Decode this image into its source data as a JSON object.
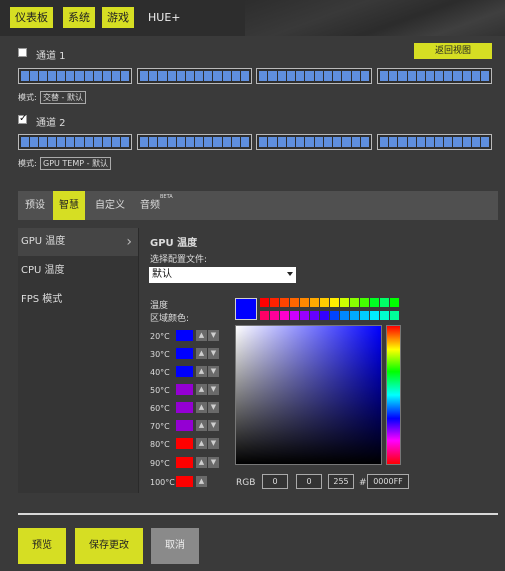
{
  "nav": {
    "dashboard": "仪表板",
    "system": "系统",
    "game": "游戏",
    "hue": "HUE+"
  },
  "return_view": "返回视图",
  "channel1": {
    "label": "通道 1",
    "checked": false,
    "mode_label": "模式:",
    "mode_value": "交替 - 默认"
  },
  "channel2": {
    "label": "通道 2",
    "checked": true,
    "mode_label": "模式:",
    "mode_value": "GPU TEMP - 默认"
  },
  "led_color": "#5f8fde",
  "tabs": [
    {
      "label": "预设"
    },
    {
      "label": "智慧"
    },
    {
      "label": "自定义"
    },
    {
      "label": "音频",
      "badge": "BETA"
    }
  ],
  "sidebar": [
    {
      "label": "GPU 温度"
    },
    {
      "label": "CPU 温度"
    },
    {
      "label": "FPS 模式"
    }
  ],
  "panel": {
    "title": "GPU 温度",
    "profile_label": "选择配置文件:",
    "profile_value": "默认",
    "zone_title": "温度",
    "zone_subtitle": "区域颜色:"
  },
  "temps": [
    {
      "label": "20°C",
      "color": "#0000ff"
    },
    {
      "label": "30°C",
      "color": "#0000ff"
    },
    {
      "label": "40°C",
      "color": "#0000ff"
    },
    {
      "label": "50°C",
      "color": "#9400d3"
    },
    {
      "label": "60°C",
      "color": "#9400d3"
    },
    {
      "label": "70°C",
      "color": "#9400d3"
    },
    {
      "label": "80°C",
      "color": "#ff0000"
    },
    {
      "label": "90°C",
      "color": "#ff0000"
    },
    {
      "label": "100°C",
      "color": "#ff0000"
    }
  ],
  "arrow_icons": {
    "up": "▲",
    "down": "▼"
  },
  "palette_row1": [
    "#ff0000",
    "#ff2200",
    "#ff4400",
    "#ff6600",
    "#ff8800",
    "#ffaa00",
    "#ffcc00",
    "#ffee00",
    "#ccff00",
    "#88ff00",
    "#44ff00",
    "#00ff22",
    "#00ff66",
    "#00ff00"
  ],
  "palette_row2": [
    "#ff0066",
    "#ff0099",
    "#ff00cc",
    "#cc00ff",
    "#9900ff",
    "#6600ff",
    "#3300ff",
    "#0044ff",
    "#0088ff",
    "#00aaff",
    "#00ccff",
    "#00eeff",
    "#00ffcc",
    "#00ff99"
  ],
  "selected_color": "#0000ff",
  "rgb": {
    "label": "RGB",
    "r": "0",
    "g": "0",
    "b": "255",
    "hash": "#",
    "hex": "0000FF"
  },
  "buttons": {
    "preview": "预览",
    "save": "保存更改",
    "cancel": "取消"
  }
}
